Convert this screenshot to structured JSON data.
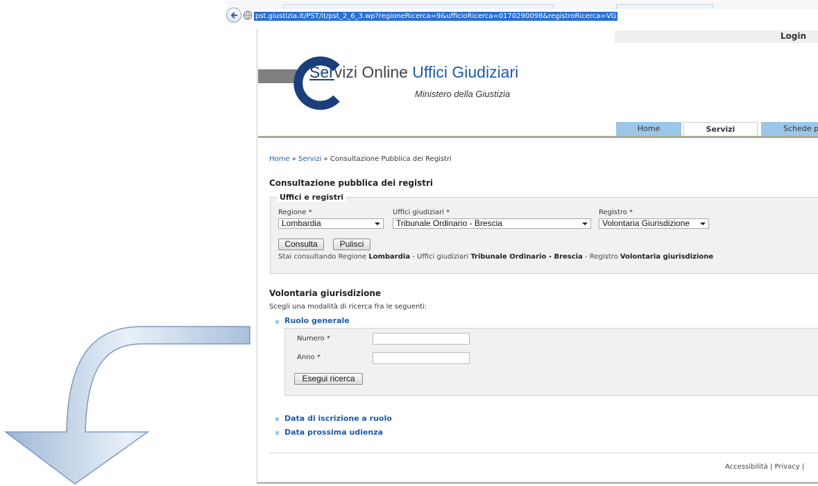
{
  "browser": {
    "url": "pst.giustizia.it/PST/it/pst_2_6_3.wp?regioneRicerca=9&ufficioRicerca=0170290098&registroRicerca=VG"
  },
  "header": {
    "login": "Login",
    "logo_servizi_part1": "Ser",
    "logo_servizi_part2": "vizi",
    "logo_online": " Online ",
    "logo_uffici": "Uffici Giudiziari",
    "logo_subtitle": "Ministero della Giustizia",
    "colors": {
      "brand_blue": "#1e5aa8",
      "tab_blue": "#9cc6e8"
    }
  },
  "tabs": [
    {
      "label": "Home",
      "active": false
    },
    {
      "label": "Servizi",
      "active": true
    },
    {
      "label": "Schede pr",
      "active": false
    }
  ],
  "breadcrumb": {
    "home": "Home",
    "sep1": " » ",
    "servizi": "Servizi",
    "sep2": " » ",
    "current": "Consultazione Pubblica dei Registri"
  },
  "consultazione": {
    "title": "Consultazione pubblica dei registri",
    "legend": "Uffici e registri",
    "regione_label": "Regione *",
    "regione_value": "Lombardia",
    "uffici_label": "Uffici giudiziari *",
    "uffici_value": "Tribunale Ordinario - Brescia",
    "registro_label": "Registro *",
    "registro_value": "Volontaria Giurisdizione",
    "consulta_button": "Consulta",
    "pulisci_button": "Pulisci",
    "status_prefix": "Stai consultando Regione ",
    "status_regione": "Lombardia",
    "status_mid1": " - Uffici giudiziari ",
    "status_ufficio": "Tribunale Ordinario - Brescia",
    "status_mid2": " - Registro ",
    "status_registro": "Volontaria giurisdizione"
  },
  "volontaria": {
    "title": "Volontaria giurisdizione",
    "intro": "Scegli una modalità di ricerca fra le seguenti:",
    "ruolo_generale": "Ruolo generale",
    "numero_label": "Numero *",
    "numero_value": "",
    "anno_label": "Anno *",
    "anno_value": "",
    "esegui_button": "Esegui ricerca",
    "data_iscrizione": "Data di iscrizione a ruolo",
    "data_udienza": "Data prossima udienza"
  },
  "footer": {
    "accessibilita": "Accessibilità",
    "separator": " | ",
    "privacy": "Privacy |"
  },
  "overlay": {
    "arrow": "curved-down-arrow",
    "arrow_color": "#b8cde6"
  }
}
